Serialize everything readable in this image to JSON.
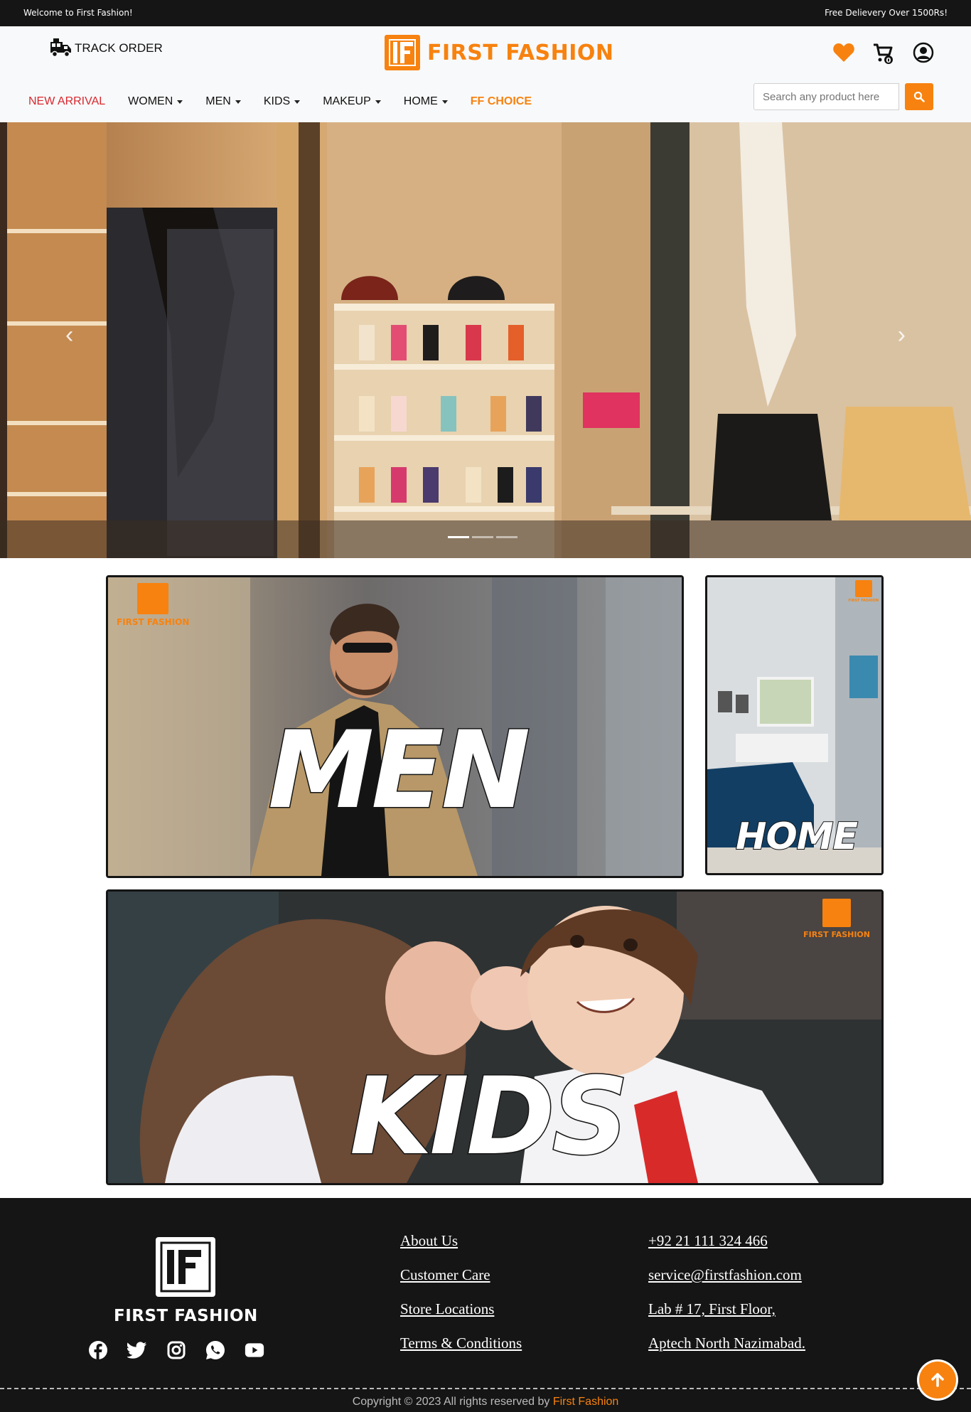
{
  "topbar": {
    "welcome": "Welcome to First Fashion!",
    "delivery": "Free Delievery Over 1500Rs!"
  },
  "header": {
    "track_order": "TRACK ORDER",
    "logo_text": "FIRST FASHION",
    "icons": [
      "truck-icon",
      "heart-icon",
      "cart-icon",
      "user-icon"
    ],
    "cart_count": "0"
  },
  "nav": {
    "items": [
      {
        "label": "NEW ARRIVAL",
        "dropdown": false
      },
      {
        "label": "WOMEN",
        "dropdown": true
      },
      {
        "label": "MEN",
        "dropdown": true
      },
      {
        "label": "KIDS",
        "dropdown": true
      },
      {
        "label": "MAKEUP",
        "dropdown": true
      },
      {
        "label": "HOME",
        "dropdown": true
      },
      {
        "label": "FF CHOICE",
        "dropdown": false
      }
    ]
  },
  "search": {
    "placeholder": "Search any product here"
  },
  "hero": {
    "slide_count": 3,
    "active_slide": 1
  },
  "categories": {
    "men": {
      "label": "MEN",
      "badge": "FIRST FASHION"
    },
    "home": {
      "label": "HOME",
      "badge": "FIRST FASHION"
    },
    "kids": {
      "label": "KIDS",
      "badge": "FIRST FASHION"
    }
  },
  "footer": {
    "logo_text": "FIRST FASHION",
    "links": [
      "About Us",
      "Customer Care",
      "Store Locations",
      "Terms & Conditions"
    ],
    "contact": [
      "+92 21 111 324 466",
      "service@firstfashion.com",
      "Lab # 17, First Floor,",
      "Aptech North Nazimabad."
    ],
    "socials": [
      "facebook-icon",
      "twitter-icon",
      "instagram-icon",
      "whatsapp-icon",
      "youtube-icon"
    ],
    "copyright_prefix": "Copyright © 2023 All rights reserved by ",
    "copyright_brand": "First Fashion"
  },
  "colors": {
    "brand_orange": "#f7820f",
    "dark": "#151515",
    "nav_active": "#d9272e"
  }
}
